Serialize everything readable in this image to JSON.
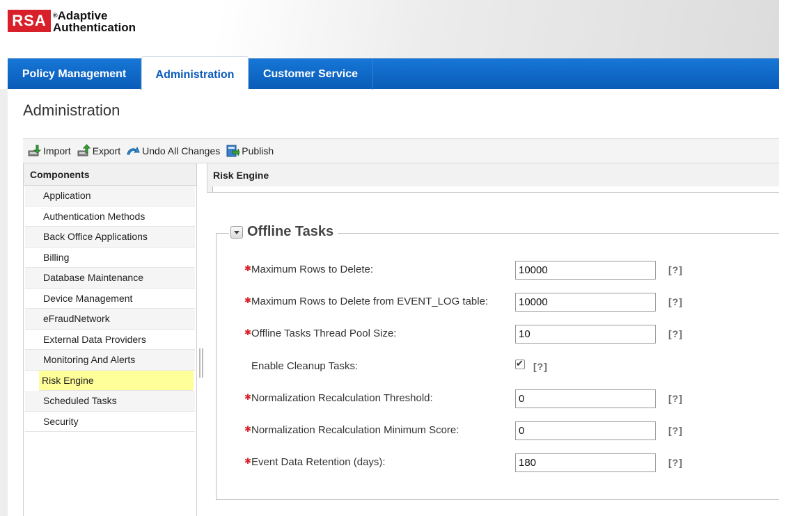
{
  "logo": {
    "mark": "RSA",
    "line1": "Adaptive",
    "line2": "Authentication",
    "reg": "®"
  },
  "nav": {
    "tabs": [
      {
        "label": "Policy Management"
      },
      {
        "label": "Administration"
      },
      {
        "label": "Customer Service"
      }
    ]
  },
  "page": {
    "title": "Administration"
  },
  "toolbar": {
    "import": "Import",
    "export": "Export",
    "undo": "Undo All Changes",
    "publish": "Publish"
  },
  "components": {
    "header": "Components",
    "items": [
      {
        "label": "Application"
      },
      {
        "label": "Authentication Methods"
      },
      {
        "label": "Back Office Applications"
      },
      {
        "label": "Billing"
      },
      {
        "label": "Database Maintenance"
      },
      {
        "label": "Device Management"
      },
      {
        "label": "eFraudNetwork"
      },
      {
        "label": "External Data Providers"
      },
      {
        "label": "Monitoring And Alerts"
      },
      {
        "label": "Risk Engine"
      },
      {
        "label": "Scheduled Tasks"
      },
      {
        "label": "Security"
      }
    ]
  },
  "detail": {
    "header": "Risk Engine",
    "section_title": "Offline Tasks",
    "help_text": "[?]",
    "required_mark": "✱",
    "fields": [
      {
        "label": "Maximum Rows to Delete:",
        "value": "10000"
      },
      {
        "label": "Maximum Rows to Delete from EVENT_LOG table:",
        "value": "10000"
      },
      {
        "label": "Offline Tasks Thread Pool Size:",
        "value": "10"
      },
      {
        "label": "Enable Cleanup Tasks:",
        "checked": true
      },
      {
        "label": "Normalization Recalculation Threshold:",
        "value": "0"
      },
      {
        "label": "Normalization Recalculation Minimum Score:",
        "value": "0"
      },
      {
        "label": "Event Data Retention (days):",
        "value": "180"
      }
    ]
  },
  "colors": {
    "brand_red": "#d8202a",
    "nav_blue": "#0a5cb8",
    "selected_bg": "#ffff99"
  }
}
